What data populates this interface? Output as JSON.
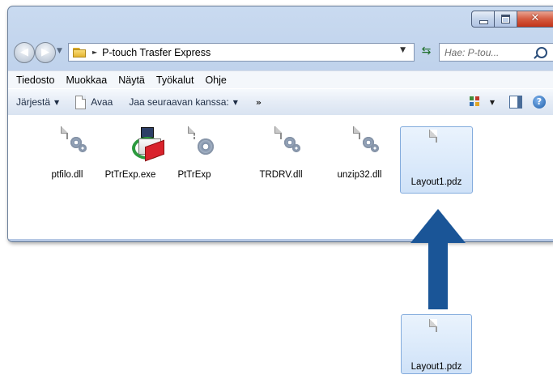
{
  "window": {
    "address": {
      "path": "P-touch Trasfer Express",
      "separator": "►"
    },
    "search": {
      "placeholder": "Hae: P-tou..."
    }
  },
  "menu": {
    "items": [
      "Tiedosto",
      "Muokkaa",
      "Näytä",
      "Työkalut",
      "Ohje"
    ]
  },
  "commands": {
    "organize": "Järjestä",
    "open": "Avaa",
    "share": "Jaa seuraavan kanssa:",
    "more": "»"
  },
  "files": [
    {
      "name": "ptfilo.dll",
      "icon": "dll-gear-icon"
    },
    {
      "name": "PtTrExp.exe",
      "icon": "ptouch-transfer-exe-icon"
    },
    {
      "name": "PtTrExp",
      "icon": "settings-file-icon"
    },
    {
      "name": "TRDRV.dll",
      "icon": "dll-gear-icon"
    },
    {
      "name": "unzip32.dll",
      "icon": "dll-gear-icon"
    },
    {
      "name": "Layout1.pdz",
      "icon": "document-icon",
      "selected": true
    }
  ],
  "dragged_file": {
    "name": "Layout1.pdz",
    "icon": "document-icon"
  },
  "colors": {
    "arrow": "#1a5597",
    "selection": "#cfe2f8",
    "window_frame": "#b4c9e6",
    "close_button": "#d55b40"
  }
}
